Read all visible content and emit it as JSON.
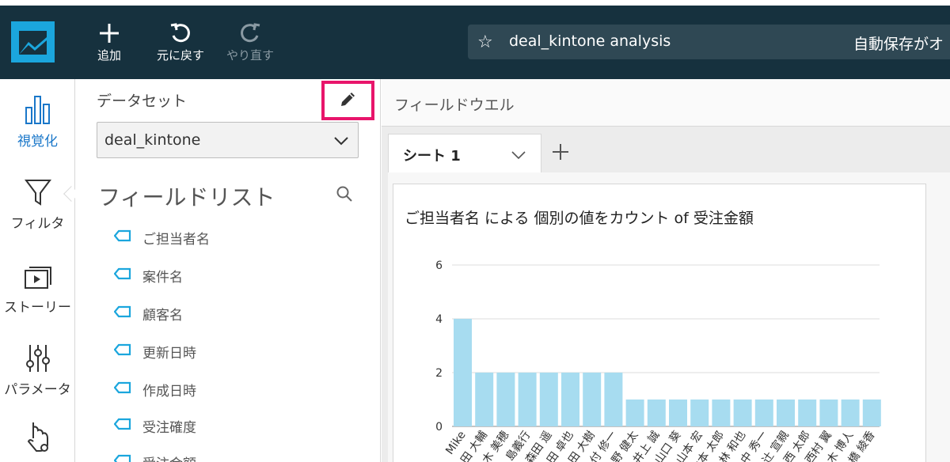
{
  "toolbar": {
    "add_label": "追加",
    "undo_label": "元に戻す",
    "redo_label": "やり直す",
    "analysis_title": "deal_kintone analysis",
    "autosave_label": "自動保存がオ"
  },
  "rail": {
    "items": [
      {
        "label": "視覚化",
        "icon": "bar-chart-icon",
        "active": true
      },
      {
        "label": "フィルタ",
        "icon": "filter-icon"
      },
      {
        "label": "ストーリー",
        "icon": "story-icon"
      },
      {
        "label": "パラメータ",
        "icon": "sliders-icon"
      },
      {
        "label": "",
        "icon": "touch-settings-icon"
      }
    ]
  },
  "data_panel": {
    "dataset_label": "データセット",
    "dataset_value": "deal_kintone",
    "field_list_title": "フィールドリスト",
    "fields": [
      "ご担当者名",
      "案件名",
      "顧客名",
      "更新日時",
      "作成日時",
      "受注確度",
      "受注金額"
    ]
  },
  "main": {
    "field_well_label": "フィールドウエル",
    "sheet_tab_label": "シート 1",
    "visual_title": "ご担当者名 による 個別の値をカウント of 受注金額"
  },
  "colors": {
    "toolbar_bg": "#16313e",
    "logo": "#1ba6dd",
    "accent_blue": "#1a77c9",
    "highlight": "#e8156b",
    "bar": "#a7dcf0"
  },
  "chart_data": {
    "type": "bar",
    "categories": [
      "Mike",
      "田 大輔",
      "木 美穂",
      "島義行",
      "森田 遥",
      "田 卓也",
      "田 大樹",
      "付 修一",
      "野 健太",
      "井上 誠",
      "山口 葵",
      "山本 宏",
      "山本 太郎",
      "林 和也",
      "中 秀一",
      "辻 宣親",
      "西 太郎",
      "西村 翼",
      "木 博人",
      "橋 綾香"
    ],
    "values": [
      4,
      2,
      2,
      2,
      2,
      2,
      2,
      2,
      1,
      1,
      1,
      1,
      1,
      1,
      1,
      1,
      1,
      1,
      1,
      1
    ],
    "yticks": [
      "0",
      "2",
      "4",
      "6"
    ],
    "ylim": [
      0,
      6
    ],
    "grid": true
  }
}
